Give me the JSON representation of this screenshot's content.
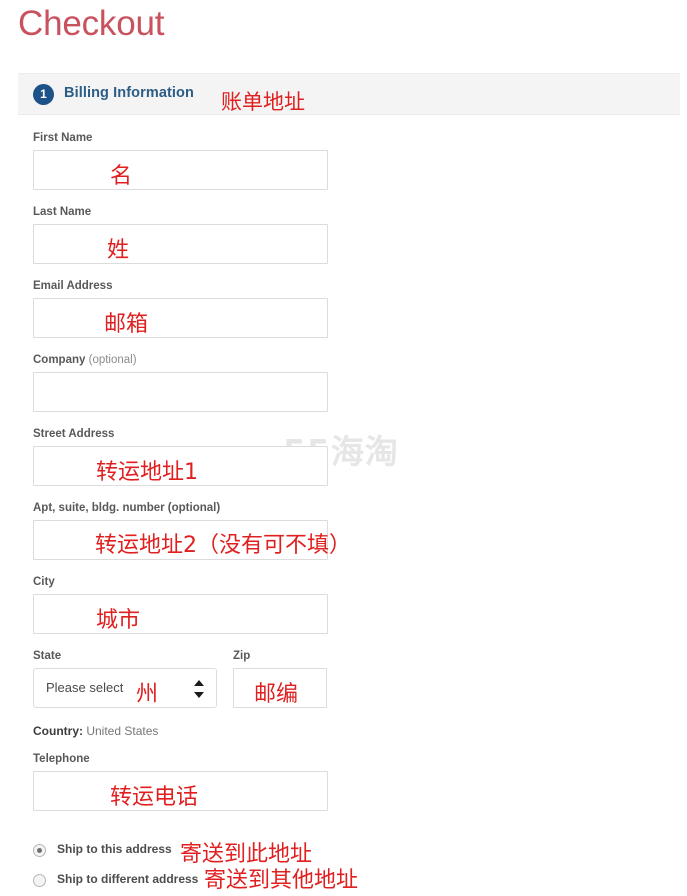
{
  "page": {
    "title": "Checkout"
  },
  "section": {
    "step_number": "1",
    "title": "Billing Information",
    "annotation": "账单地址"
  },
  "watermark": {
    "text": "55海淘"
  },
  "country": {
    "label": "Country:",
    "value": "United States"
  },
  "fields": [
    {
      "name": "first-name",
      "label": "First Name",
      "optional": "",
      "value": "",
      "annotation": "名"
    },
    {
      "name": "last-name",
      "label": "Last Name",
      "optional": "",
      "value": "",
      "annotation": "姓"
    },
    {
      "name": "email-address",
      "label": "Email Address",
      "optional": "",
      "value": "",
      "annotation": "邮箱"
    },
    {
      "name": "company",
      "label": "Company",
      "optional": "(optional)",
      "value": "",
      "annotation": ""
    },
    {
      "name": "street-address",
      "label": "Street Address",
      "optional": "",
      "value": "",
      "annotation": "转运地址1"
    },
    {
      "name": "apt-suite",
      "label": "Apt, suite, bldg. number (optional)",
      "optional": "",
      "value": "",
      "annotation": "转运地址2（没有可不填）"
    },
    {
      "name": "city",
      "label": "City",
      "optional": "",
      "value": "",
      "annotation": "城市"
    },
    {
      "name": "state",
      "label": "State",
      "optional": "",
      "value": "Please select",
      "annotation": "州"
    },
    {
      "name": "zip",
      "label": "Zip",
      "optional": "",
      "value": "",
      "annotation": "邮编"
    },
    {
      "name": "telephone",
      "label": "Telephone",
      "optional": "",
      "value": "",
      "annotation": "转运电话"
    }
  ],
  "shipping_options": [
    {
      "label": "Ship to this address",
      "annotation": "寄送到此地址",
      "selected": true
    },
    {
      "label": "Ship to different address",
      "annotation": "寄送到其他地址",
      "selected": false
    }
  ],
  "colors": {
    "title": "#c9525f",
    "annotation": "#e02020",
    "badge": "#1c5288",
    "section_title": "#2b5d86",
    "section_bg": "#f4f4f4",
    "input_border": "#dcdcdc",
    "watermark": "#e6e6e6"
  }
}
